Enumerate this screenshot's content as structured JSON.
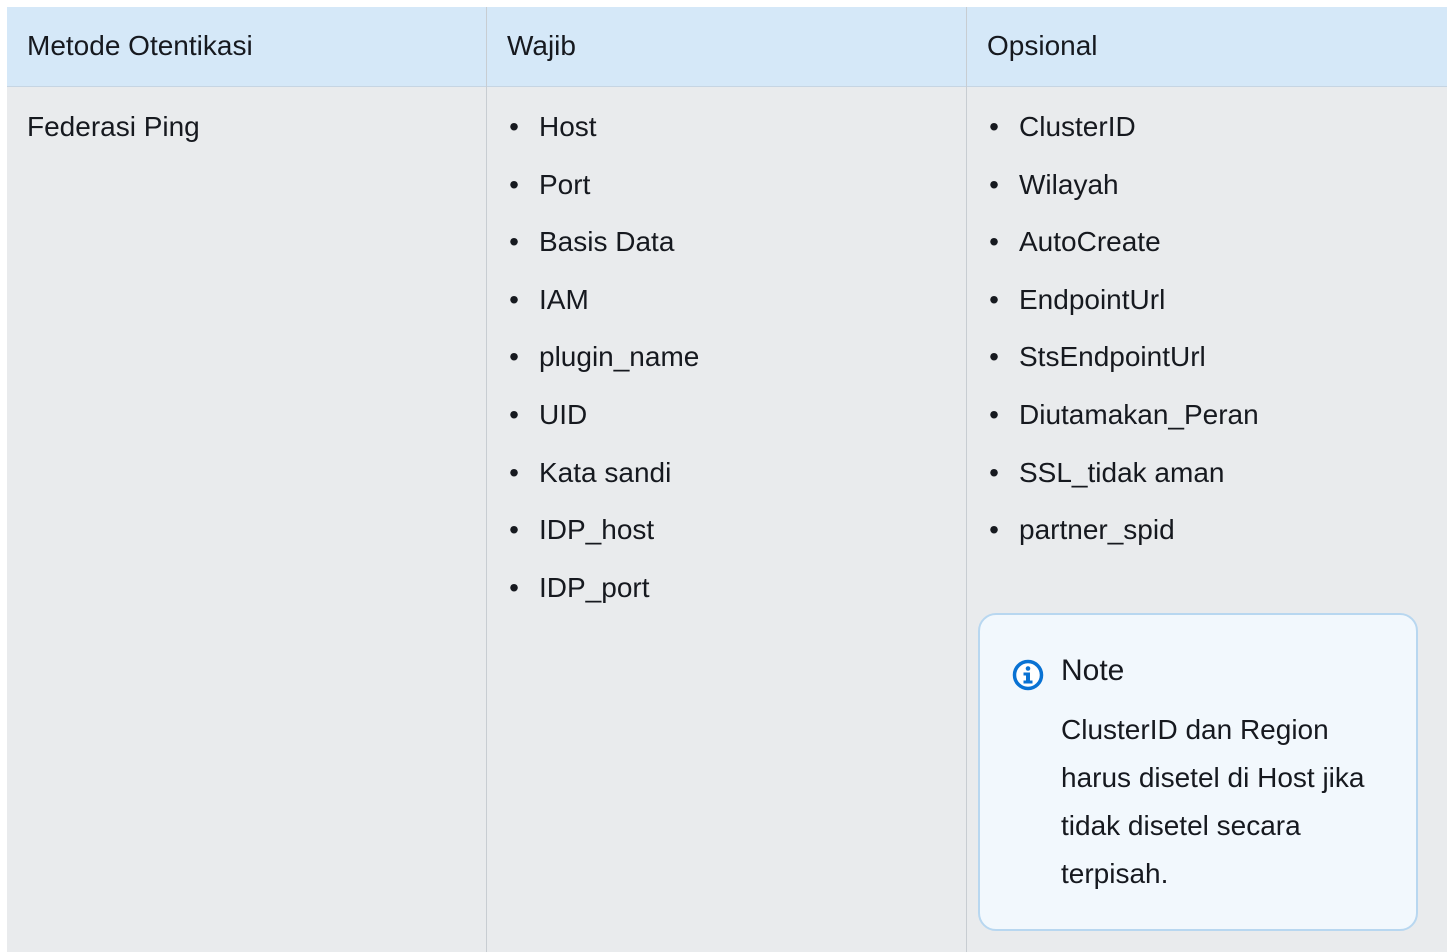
{
  "table": {
    "headers": [
      "Metode Otentikasi",
      "Wajib",
      "Opsional"
    ],
    "row": {
      "method": "Federasi Ping",
      "required": [
        "Host",
        "Port",
        "Basis Data",
        "IAM",
        "plugin_name",
        "UID",
        "Kata sandi",
        "IDP_host",
        "IDP_port"
      ],
      "optional": [
        "ClusterID",
        "Wilayah",
        "AutoCreate",
        "EndpointUrl",
        "StsEndpointUrl",
        "Diutamakan_Peran",
        "SSL_tidak aman",
        "partner_spid"
      ]
    }
  },
  "note": {
    "icon": "info-icon",
    "title": "Note",
    "text": "ClusterID dan Region harus disetel di Host jika tidak disetel secara terpisah."
  },
  "colors": {
    "header_bg": "#d5e8f8",
    "body_bg": "#e9ebed",
    "note_bg": "#f2f8fd",
    "note_border": "#b8d7f0",
    "info_icon": "#0972d3"
  }
}
